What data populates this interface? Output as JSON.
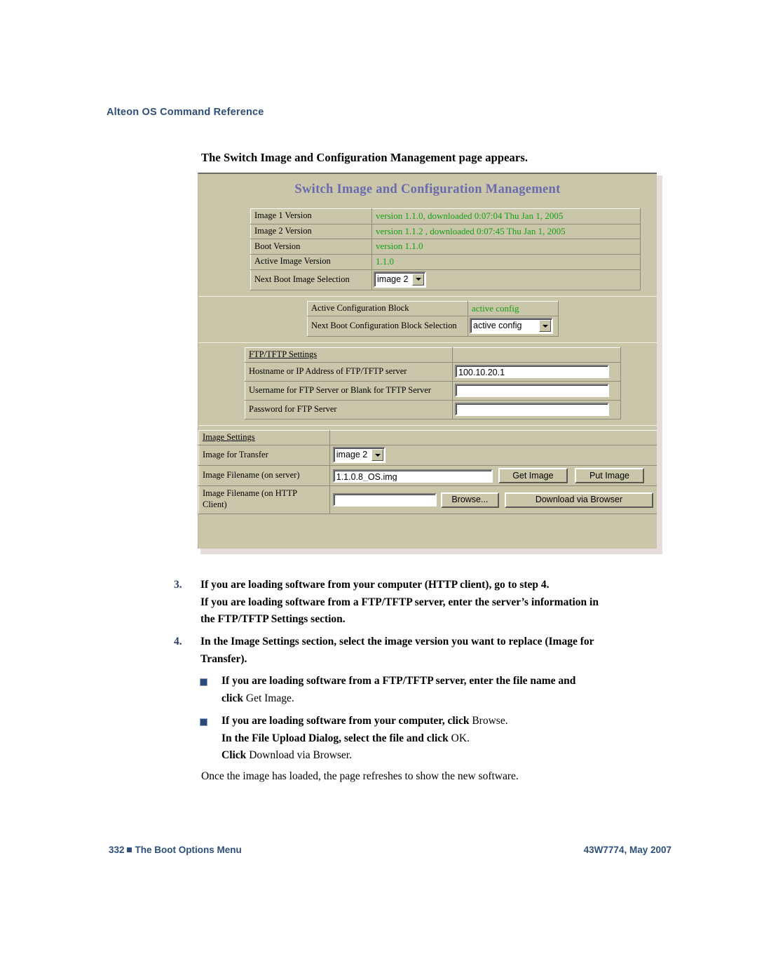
{
  "running_head": "Alteon OS Command Reference",
  "lead_heading": "The Switch Image and Configuration Management page appears.",
  "figure": {
    "panel_title": "Switch Image and Configuration Management",
    "image_table": {
      "rows": [
        {
          "label": "Image 1 Version",
          "value": "version 1.1.0, downloaded 0:07:04 Thu Jan 1, 2005",
          "type": "text"
        },
        {
          "label": "Image 2 Version",
          "value": "version 1.1.2 , downloaded 0:07:45 Thu Jan 1, 2005",
          "type": "text"
        },
        {
          "label": "Boot Version",
          "value": "version 1.1.0",
          "type": "text"
        },
        {
          "label": "Active Image Version",
          "value": "1.1.0",
          "type": "text"
        },
        {
          "label": "Next Boot Image Selection",
          "value": "image 2",
          "type": "select"
        }
      ]
    },
    "config_table": {
      "rows": [
        {
          "label": "Active Configuration Block",
          "value": "active config",
          "type": "text"
        },
        {
          "label": "Next Boot Configuration Block Selection",
          "value": "active config",
          "type": "select"
        }
      ]
    },
    "ftp_table": {
      "section_label": "FTP/TFTP Settings",
      "rows": [
        {
          "label": "Hostname or IP Address of FTP/TFTP server",
          "value": "100.10.20.1"
        },
        {
          "label": "Username for FTP Server or Blank for TFTP Server",
          "value": ""
        },
        {
          "label": "Password for FTP Server",
          "value": ""
        }
      ]
    },
    "image_settings": {
      "section_label": "Image Settings",
      "transfer_label": "Image for Transfer",
      "transfer_value": "image 2",
      "server_file_label": "Image Filename (on server)",
      "server_file_value": "1.1.0.8_OS.img",
      "get_image_button": "Get Image",
      "put_image_button": "Put Image",
      "http_file_label_line1": "Image Filename (on HTTP",
      "http_file_label_line2": "Client)",
      "http_file_value": "",
      "browse_button": "Browse...",
      "download_button": "Download via Browser"
    }
  },
  "steps": [
    {
      "number": "3.",
      "lines": [
        "If you are loading software from your computer (HTTP client), go to step 4.",
        "If you are loading software from a FTP/TFTP server, enter the server’s information in",
        "the FTP/TFTP Settings section."
      ]
    },
    {
      "number": "4.",
      "lines": [
        "In the Image Settings section, select the image version you want to replace (Image for",
        "Transfer)."
      ]
    }
  ],
  "bullets": [
    {
      "line1_bold": "If you are loading software from a FTP/TFTP server, enter the file name and",
      "line2_bold": "click ",
      "line2_regular": "Get Image."
    },
    {
      "line1_bold": "If you are loading software from your computer, click ",
      "line1_regular": "Browse.",
      "line2_bold": "In the File Upload Dialog, select the file and click ",
      "line2_regular": "OK.",
      "line3_bold": "Click ",
      "line3_regular": "Download via Browser."
    }
  ],
  "closing_paragraph": "Once the image has loaded, the page refreshes to show the new software.",
  "footer": {
    "page_number": "332",
    "section_title": "The Boot Options Menu",
    "doc_id": "43W7774, May 2007"
  }
}
